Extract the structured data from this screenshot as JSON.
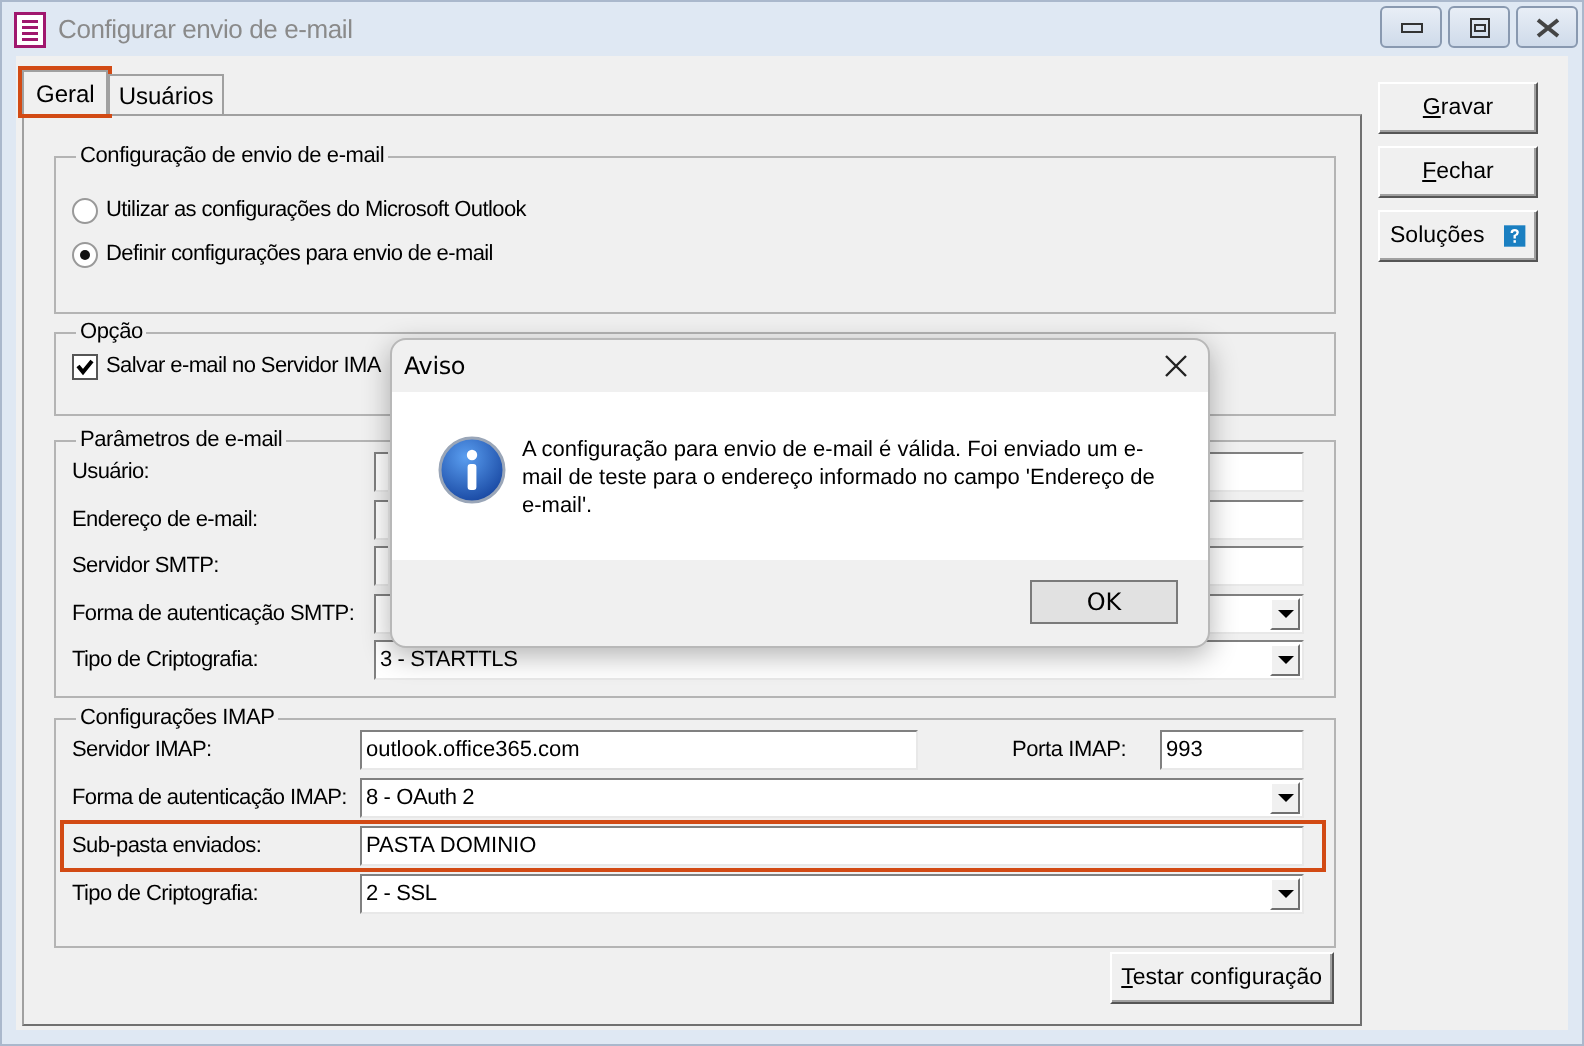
{
  "window": {
    "title": "Configurar envio de e-mail"
  },
  "tabs": [
    {
      "label": "Geral",
      "selected": true,
      "highlighted": true
    },
    {
      "label": "Usuários",
      "selected": false,
      "highlighted": false
    }
  ],
  "send_config": {
    "title": "Configuração de envio de e-mail",
    "options": [
      {
        "label": "Utilizar as configurações do Microsoft Outlook",
        "selected": false
      },
      {
        "label": "Definir configurações para envio de e-mail",
        "selected": true
      }
    ]
  },
  "option": {
    "title": "Opção",
    "checkbox": {
      "label": "Salvar e-mail no Servidor IMA",
      "checked": true
    }
  },
  "email_params": {
    "title": "Parâmetros de e-mail",
    "fields": [
      {
        "kind": "text",
        "label": "Usuário:"
      },
      {
        "kind": "text",
        "label": "Endereço de e-mail:"
      },
      {
        "kind": "text",
        "label": "Servidor SMTP:"
      },
      {
        "kind": "select",
        "label": "Forma de autenticação SMTP:"
      },
      {
        "kind": "select",
        "label": "Tipo de Criptografia:",
        "value": "3 - STARTTLS"
      }
    ]
  },
  "imap": {
    "title": "Configurações IMAP",
    "server": {
      "label": "Servidor IMAP:",
      "value": "outlook.office365.com"
    },
    "port": {
      "label": "Porta IMAP:",
      "value": "993"
    },
    "fields": [
      {
        "kind": "select",
        "label": "Forma de autenticação IMAP:",
        "value": "8 - OAuth 2"
      },
      {
        "kind": "text",
        "label": "Sub-pasta enviados:",
        "value": "PASTA DOMINIO",
        "highlighted": true
      },
      {
        "kind": "select",
        "label": "Tipo de Criptografia:",
        "value": "2 - SSL"
      }
    ]
  },
  "test_button": "Testar configuração",
  "side_buttons": [
    {
      "label": "Gravar",
      "mnemonic": true,
      "help": false
    },
    {
      "label": "Fechar",
      "mnemonic": true,
      "help": false
    },
    {
      "label": "Soluções",
      "mnemonic": false,
      "help": true
    }
  ],
  "dialog": {
    "title": "Aviso",
    "message": "A configuração para envio de e-mail é válida. Foi enviado um e-mail de teste para o endereço informado no campo 'Endereço de e-mail'.",
    "button": "OK"
  }
}
